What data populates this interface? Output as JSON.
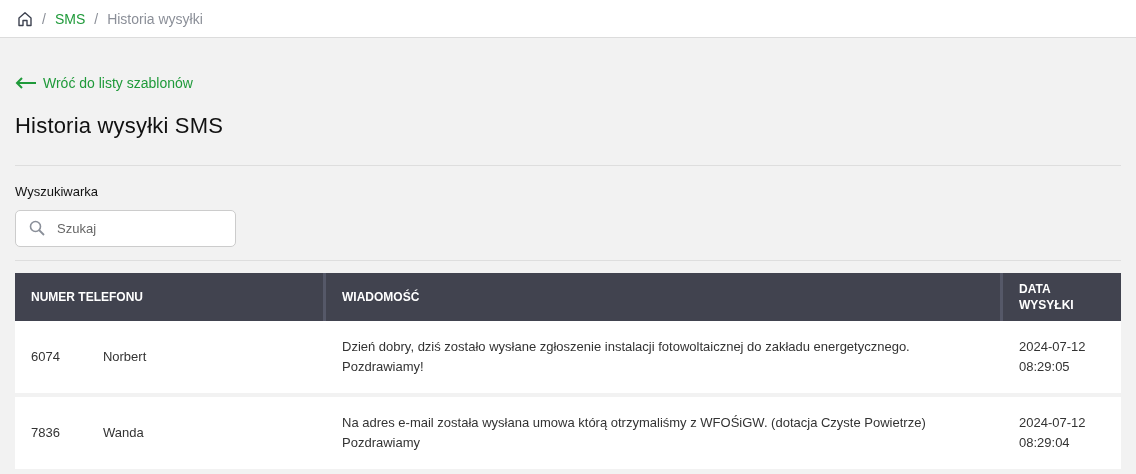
{
  "breadcrumb": {
    "separator": "/",
    "items": [
      {
        "label": "SMS",
        "link": true
      },
      {
        "label": "Historia wysyłki",
        "link": false
      }
    ]
  },
  "back_link": "Wróć do listy szablonów",
  "title": "Historia wysyłki SMS",
  "search": {
    "label": "Wyszukiwarka",
    "placeholder": "Szukaj"
  },
  "table": {
    "columns": [
      "NUMER TELEFONU",
      "WIADOMOŚĆ",
      "DATA\nWYSYŁKI"
    ],
    "rows": [
      {
        "number": "6074",
        "name": "Norbert",
        "message": "Dzień dobry, dziś zostało wysłane zgłoszenie instalacji fotowoltaicznej do zakładu energetycznego.\nPozdrawiamy!",
        "date": "2024-07-12\n08:29:05"
      },
      {
        "number": "7836",
        "name": "Wanda",
        "message": "Na adres e-mail została wysłana umowa którą otrzymaliśmy z WFOŚiGW. (dotacja Czyste Powietrze)\nPozdrawiamy",
        "date": "2024-07-12\n08:29:04"
      }
    ]
  }
}
